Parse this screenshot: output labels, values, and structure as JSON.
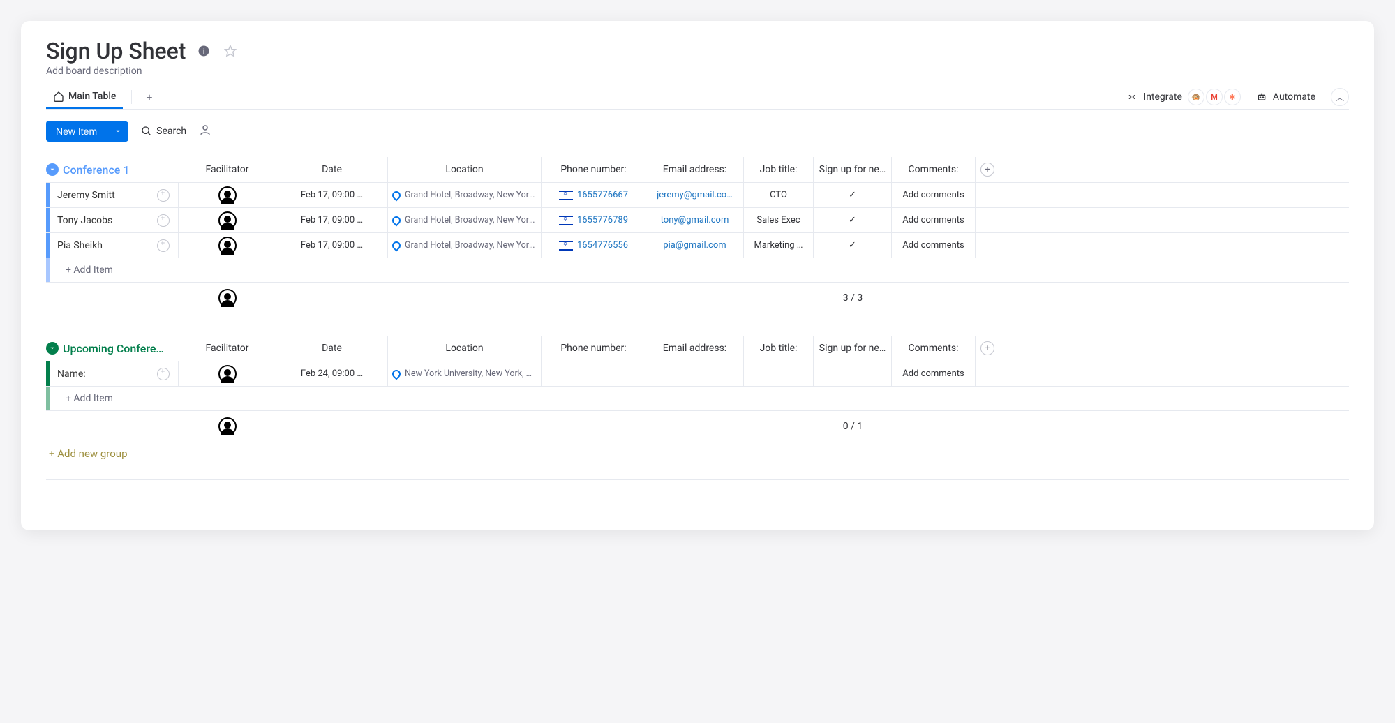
{
  "board": {
    "title": "Sign Up Sheet",
    "description_placeholder": "Add board description",
    "main_tab": "Main Table",
    "integrate_label": "Integrate",
    "automate_label": "Automate",
    "new_item_label": "New Item",
    "search_label": "Search",
    "add_group_label": "+ Add new group"
  },
  "columns": {
    "facilitator": "Facilitator",
    "date": "Date",
    "location": "Location",
    "phone": "Phone number:",
    "email": "Email address:",
    "job": "Job title:",
    "signup": "Sign up for ne…",
    "comments": "Comments:"
  },
  "groups": [
    {
      "title": "Conference 1",
      "color": "#579bfc",
      "summary": "3 / 3",
      "add_item": "+ Add Item",
      "rows": [
        {
          "name": "Jeremy Smitt",
          "date": "Feb 17, 09:00 …",
          "location": "Grand Hotel, Broadway, New York, …",
          "phone": "1655776667",
          "email": "jeremy@gmail.co…",
          "job": "CTO",
          "signup": "✓",
          "comments": "Add comments"
        },
        {
          "name": "Tony Jacobs",
          "date": "Feb 17, 09:00 …",
          "location": "Grand Hotel, Broadway, New York, …",
          "phone": "1655776789",
          "email": "tony@gmail.com",
          "job": "Sales Exec",
          "signup": "✓",
          "comments": "Add comments"
        },
        {
          "name": "Pia Sheikh",
          "date": "Feb 17, 09:00 …",
          "location": "Grand Hotel, Broadway, New York, …",
          "phone": "1654776556",
          "email": "pia@gmail.com",
          "job": "Marketing …",
          "signup": "✓",
          "comments": "Add comments"
        }
      ]
    },
    {
      "title": "Upcoming Confere…",
      "color": "#037f4c",
      "summary": "0 / 1",
      "add_item": "+ Add Item",
      "rows": [
        {
          "name": "Name:",
          "date": "Feb 24, 09:00 …",
          "location": "New York University, New York, NY,…",
          "phone": "",
          "email": "",
          "job": "",
          "signup": "",
          "comments": "Add comments"
        }
      ]
    }
  ]
}
